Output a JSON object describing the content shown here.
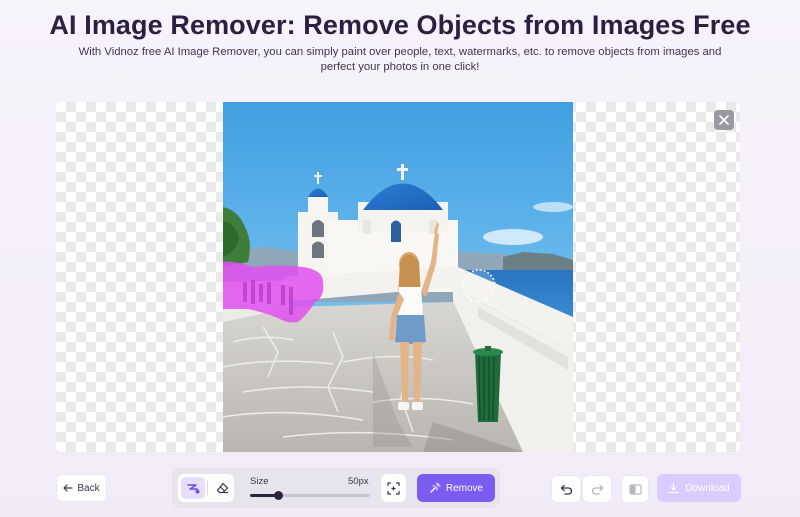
{
  "header": {
    "title": "AI Image Remover: Remove Objects from Images Free",
    "subtitle": "With Vidnoz free AI Image Remover, you can simply paint over people, text, watermarks, etc. to remove objects from images and perfect your photos in one click!"
  },
  "canvas": {
    "close_icon": "close-icon",
    "image_alt": "Woman on Santorini terrace with blue-domed church",
    "mask_color": "#e14ff0"
  },
  "toolbar": {
    "back_label": "Back",
    "brush_icon": "brush-icon",
    "eraser_icon": "eraser-icon",
    "size_label": "Size",
    "size_value": "50px",
    "size_fraction": 0.23,
    "fit_icon": "fit-screen-icon",
    "remove_label": "Remove",
    "undo_icon": "undo-icon",
    "redo_icon": "redo-icon",
    "compare_icon": "compare-icon",
    "download_label": "Download"
  },
  "colors": {
    "accent": "#7a5cf2",
    "accent_disabled": "#d9ccff",
    "title": "#2a2140"
  }
}
